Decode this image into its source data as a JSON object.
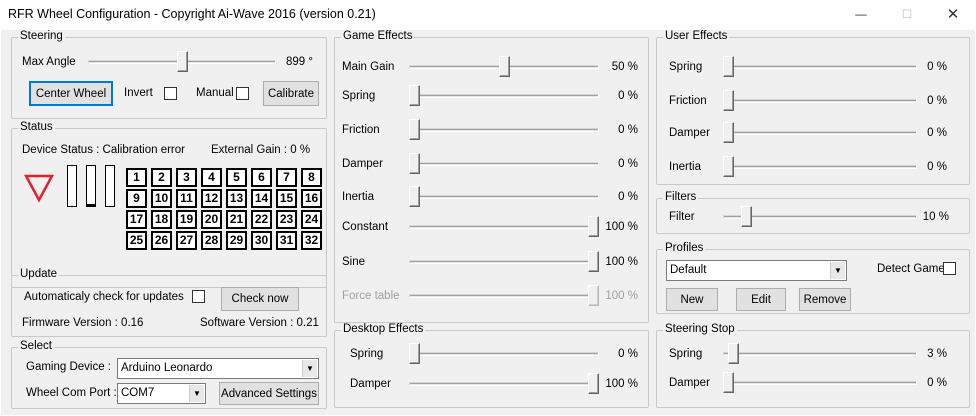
{
  "window": {
    "title": "RFR Wheel Configuration - Copyright Ai-Wave 2016 (version 0.21)",
    "minimize_glyph": "—",
    "maximize_glyph": "☐",
    "close_glyph": "✕"
  },
  "steering": {
    "title": "Steering",
    "max_angle_label": "Max Angle",
    "max_angle_value": "899 °",
    "max_angle_fraction": 0.5,
    "center_wheel": "Center Wheel",
    "invert_label": "Invert",
    "manual_label": "Manual",
    "calibrate": "Calibrate"
  },
  "status": {
    "title": "Status",
    "device_status": "Device Status :  Calibration error",
    "external_gain": "External Gain :  0 %",
    "bar_levels": [
      0,
      0.05,
      0
    ],
    "buttons": [
      "1",
      "2",
      "3",
      "4",
      "5",
      "6",
      "7",
      "8",
      "9",
      "10",
      "11",
      "12",
      "13",
      "14",
      "15",
      "16",
      "17",
      "18",
      "19",
      "20",
      "21",
      "22",
      "23",
      "24",
      "25",
      "26",
      "27",
      "28",
      "29",
      "30",
      "31",
      "32"
    ]
  },
  "update": {
    "title": "Update",
    "auto_check_label": "Automaticaly check for updates",
    "check_now": "Check now",
    "firmware": "Firmware Version : 0.16",
    "software": "Software Version :  0.21"
  },
  "select": {
    "title": "Select",
    "gaming_device_label": "Gaming Device :",
    "gaming_device_value": "Arduino Leonardo",
    "com_port_label": "Wheel Com Port :",
    "com_port_value": "COM7",
    "advanced_settings": "Advanced Settings"
  },
  "game_effects": {
    "title": "Game Effects",
    "rows": [
      {
        "label": "Main Gain",
        "value": "50 %",
        "fraction": 0.5,
        "disabled": false
      },
      {
        "label": "Spring",
        "value": "0 %",
        "fraction": 0,
        "disabled": false
      },
      {
        "label": "Friction",
        "value": "0 %",
        "fraction": 0,
        "disabled": false
      },
      {
        "label": "Damper",
        "value": "0 %",
        "fraction": 0,
        "disabled": false
      },
      {
        "label": "Inertia",
        "value": "0 %",
        "fraction": 0,
        "disabled": false
      },
      {
        "label": "Constant",
        "value": "100 %",
        "fraction": 1,
        "disabled": false
      },
      {
        "label": "Sine",
        "value": "100 %",
        "fraction": 1,
        "disabled": false
      },
      {
        "label": "Force table",
        "value": "100 %",
        "fraction": 1,
        "disabled": true
      }
    ]
  },
  "desktop_effects": {
    "title": "Desktop Effects",
    "rows": [
      {
        "label": "Spring",
        "value": "0 %",
        "fraction": 0
      },
      {
        "label": "Damper",
        "value": "100 %",
        "fraction": 1
      }
    ]
  },
  "user_effects": {
    "title": "User Effects",
    "rows": [
      {
        "label": "Spring",
        "value": "0 %",
        "fraction": 0
      },
      {
        "label": "Friction",
        "value": "0 %",
        "fraction": 0
      },
      {
        "label": "Damper",
        "value": "0 %",
        "fraction": 0
      },
      {
        "label": "Inertia",
        "value": "0 %",
        "fraction": 0
      }
    ]
  },
  "filters": {
    "title": "Filters",
    "filter_label": "Filter",
    "filter_value": "10 %",
    "filter_fraction": 0.1
  },
  "profiles": {
    "title": "Profiles",
    "selected": "Default",
    "detect_game_label": "Detect Game",
    "new": "New",
    "edit": "Edit",
    "remove": "Remove"
  },
  "steering_stop": {
    "title": "Steering Stop",
    "rows": [
      {
        "label": "Spring",
        "value": "3 %",
        "fraction": 0.03
      },
      {
        "label": "Damper",
        "value": "0 %",
        "fraction": 0
      }
    ]
  },
  "colors": {
    "triangle": "#e0202a",
    "default_button_border": "#0078d7"
  }
}
